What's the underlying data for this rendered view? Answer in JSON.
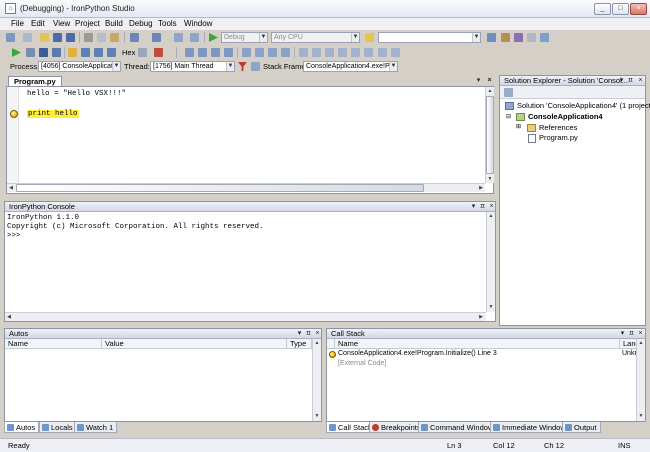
{
  "window": {
    "title": "(Debugging) - IronPython Studio",
    "min": "_",
    "max": "□",
    "close": "×"
  },
  "menu": [
    "File",
    "Edit",
    "View",
    "Project",
    "Build",
    "Debug",
    "Tools",
    "Window"
  ],
  "toolbar1": {
    "config": "Debug",
    "platform": "Any CPU",
    "find": ""
  },
  "toolbar2": {
    "hex_label": "Hex"
  },
  "debugbar": {
    "process_label": "Process:",
    "process_value": "[4056] ConsoleApplicatio",
    "thread_label": "Thread:",
    "thread_value": "[1756] Main Thread",
    "frame_label": "Stack Frame:",
    "frame_value": "ConsoleApplication4.exe!Pr"
  },
  "editor": {
    "tab": "Program.py",
    "lines": [
      "hello = \"Hello VSX!!!\"",
      "",
      "print hello"
    ],
    "current_line": 3
  },
  "solution_explorer": {
    "title": "Solution Explorer - Solution 'Consol...",
    "solution": "Solution 'ConsoleApplication4' (1 project)",
    "project": "ConsoleApplication4",
    "references": "References",
    "file": "Program.py"
  },
  "console": {
    "title": "IronPython Console",
    "lines": [
      "IronPython 1.1.0",
      "Copyright (c) Microsoft Corporation. All rights reserved.",
      ">>>"
    ]
  },
  "autos": {
    "title": "Autos",
    "columns": [
      "Name",
      "Value",
      "Type"
    ],
    "tabs": [
      "Autos",
      "Locals",
      "Watch 1"
    ]
  },
  "callstack": {
    "title": "Call Stack",
    "columns": [
      "Name",
      "Lang"
    ],
    "rows": [
      {
        "name": "ConsoleApplication4.exe!Program.Initialize() Line 3",
        "lang": "Unkn"
      },
      {
        "name": "[External Code]",
        "lang": ""
      }
    ],
    "tabs": [
      "Call Stack",
      "Breakpoints",
      "Command Window",
      "Immediate Window",
      "Output"
    ]
  },
  "status": {
    "ready": "Ready",
    "ln": "Ln 3",
    "col": "Col 12",
    "ch": "Ch 12",
    "ins": "INS"
  }
}
